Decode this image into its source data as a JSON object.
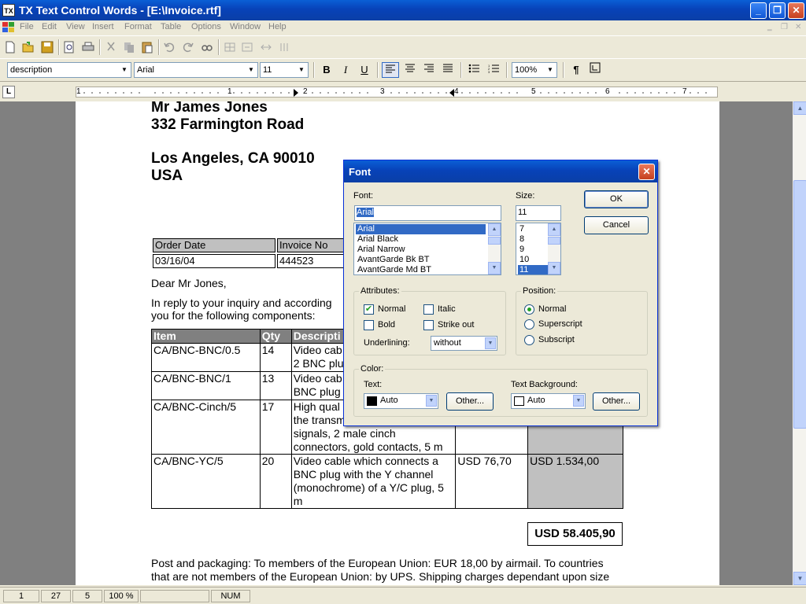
{
  "window": {
    "title": "TX Text Control Words - [E:\\Invoice.rtf]",
    "icon_label": "TX"
  },
  "menu": [
    "File",
    "Edit",
    "View",
    "Insert",
    "Format",
    "Table",
    "Options",
    "Window",
    "Help"
  ],
  "toolbar": {
    "style": "description",
    "font": "Arial",
    "size": "11",
    "bold": "B",
    "italic": "I",
    "underline": "U",
    "zoom": "100%",
    "pilcrow": "¶"
  },
  "ruler": {
    "numbers": [
      "1",
      "1",
      "2",
      "3",
      "4",
      "5",
      "6",
      "7"
    ]
  },
  "document": {
    "address": [
      "Mr James Jones",
      "332 Farmington Road",
      "Los Angeles, CA 90010",
      "USA"
    ],
    "order_table": {
      "headers": [
        "Order Date",
        "Invoice No"
      ],
      "values": [
        "03/16/04",
        "444523"
      ]
    },
    "greeting": "Dear Mr Jones,",
    "intro": [
      "In reply to your inquiry and according",
      "you for the following components:"
    ],
    "items_table": {
      "headers": [
        "Item",
        "Qty",
        "Descripti"
      ],
      "rows": [
        {
          "item": "CA/BNC-BNC/0.5",
          "qty": "14",
          "desc": [
            "Video cab",
            "2 BNC plu"
          ],
          "price": "",
          "total": ""
        },
        {
          "item": "CA/BNC-BNC/1",
          "qty": "13",
          "desc": [
            "Video cab",
            "BNC plug"
          ],
          "price": "",
          "total": ""
        },
        {
          "item": "CA/BNC-Cinch/5",
          "qty": "17",
          "desc": [
            "High qual",
            "the transm",
            "signals, 2 male cinch",
            "connectors, gold contacts, 5 m"
          ],
          "price": "",
          "total": ""
        },
        {
          "item": "CA/BNC-YC/5",
          "qty": "20",
          "desc": [
            "Video cable which connects a",
            "BNC plug with the Y channel",
            "(monochrome) of a Y/C plug, 5",
            "m"
          ],
          "price": "USD 76,70",
          "total": "USD 1.534,00"
        }
      ]
    },
    "grand_total": "USD 58.405,90",
    "footer": [
      "Post and packaging: To members of the European Union: EUR 18,00 by airmail. To countries",
      "that are not members of the European Union: by UPS. Shipping charges dependant upon size"
    ]
  },
  "statusbar": [
    "1",
    "27",
    "5",
    "100 %",
    "",
    "NUM"
  ],
  "dialog": {
    "title": "Font",
    "font_label": "Font:",
    "font_value": "Arial",
    "font_list": [
      "Arial",
      "Arial Black",
      "Arial Narrow",
      "AvantGarde Bk BT",
      "AvantGarde Md BT"
    ],
    "size_label": "Size:",
    "size_value": "11",
    "size_list": [
      "7",
      "8",
      "9",
      "10",
      "11"
    ],
    "ok": "OK",
    "cancel": "Cancel",
    "attributes": {
      "label": "Attributes:",
      "normal": "Normal",
      "italic": "Italic",
      "bold": "Bold",
      "strike": "Strike out",
      "underlining_label": "Underlining:",
      "underlining_value": "without"
    },
    "position": {
      "label": "Position:",
      "normal": "Normal",
      "superscript": "Superscript",
      "subscript": "Subscript"
    },
    "color": {
      "label": "Color:",
      "text_label": "Text:",
      "text_value": "Auto",
      "bg_label": "Text Background:",
      "bg_value": "Auto",
      "other": "Other..."
    }
  }
}
